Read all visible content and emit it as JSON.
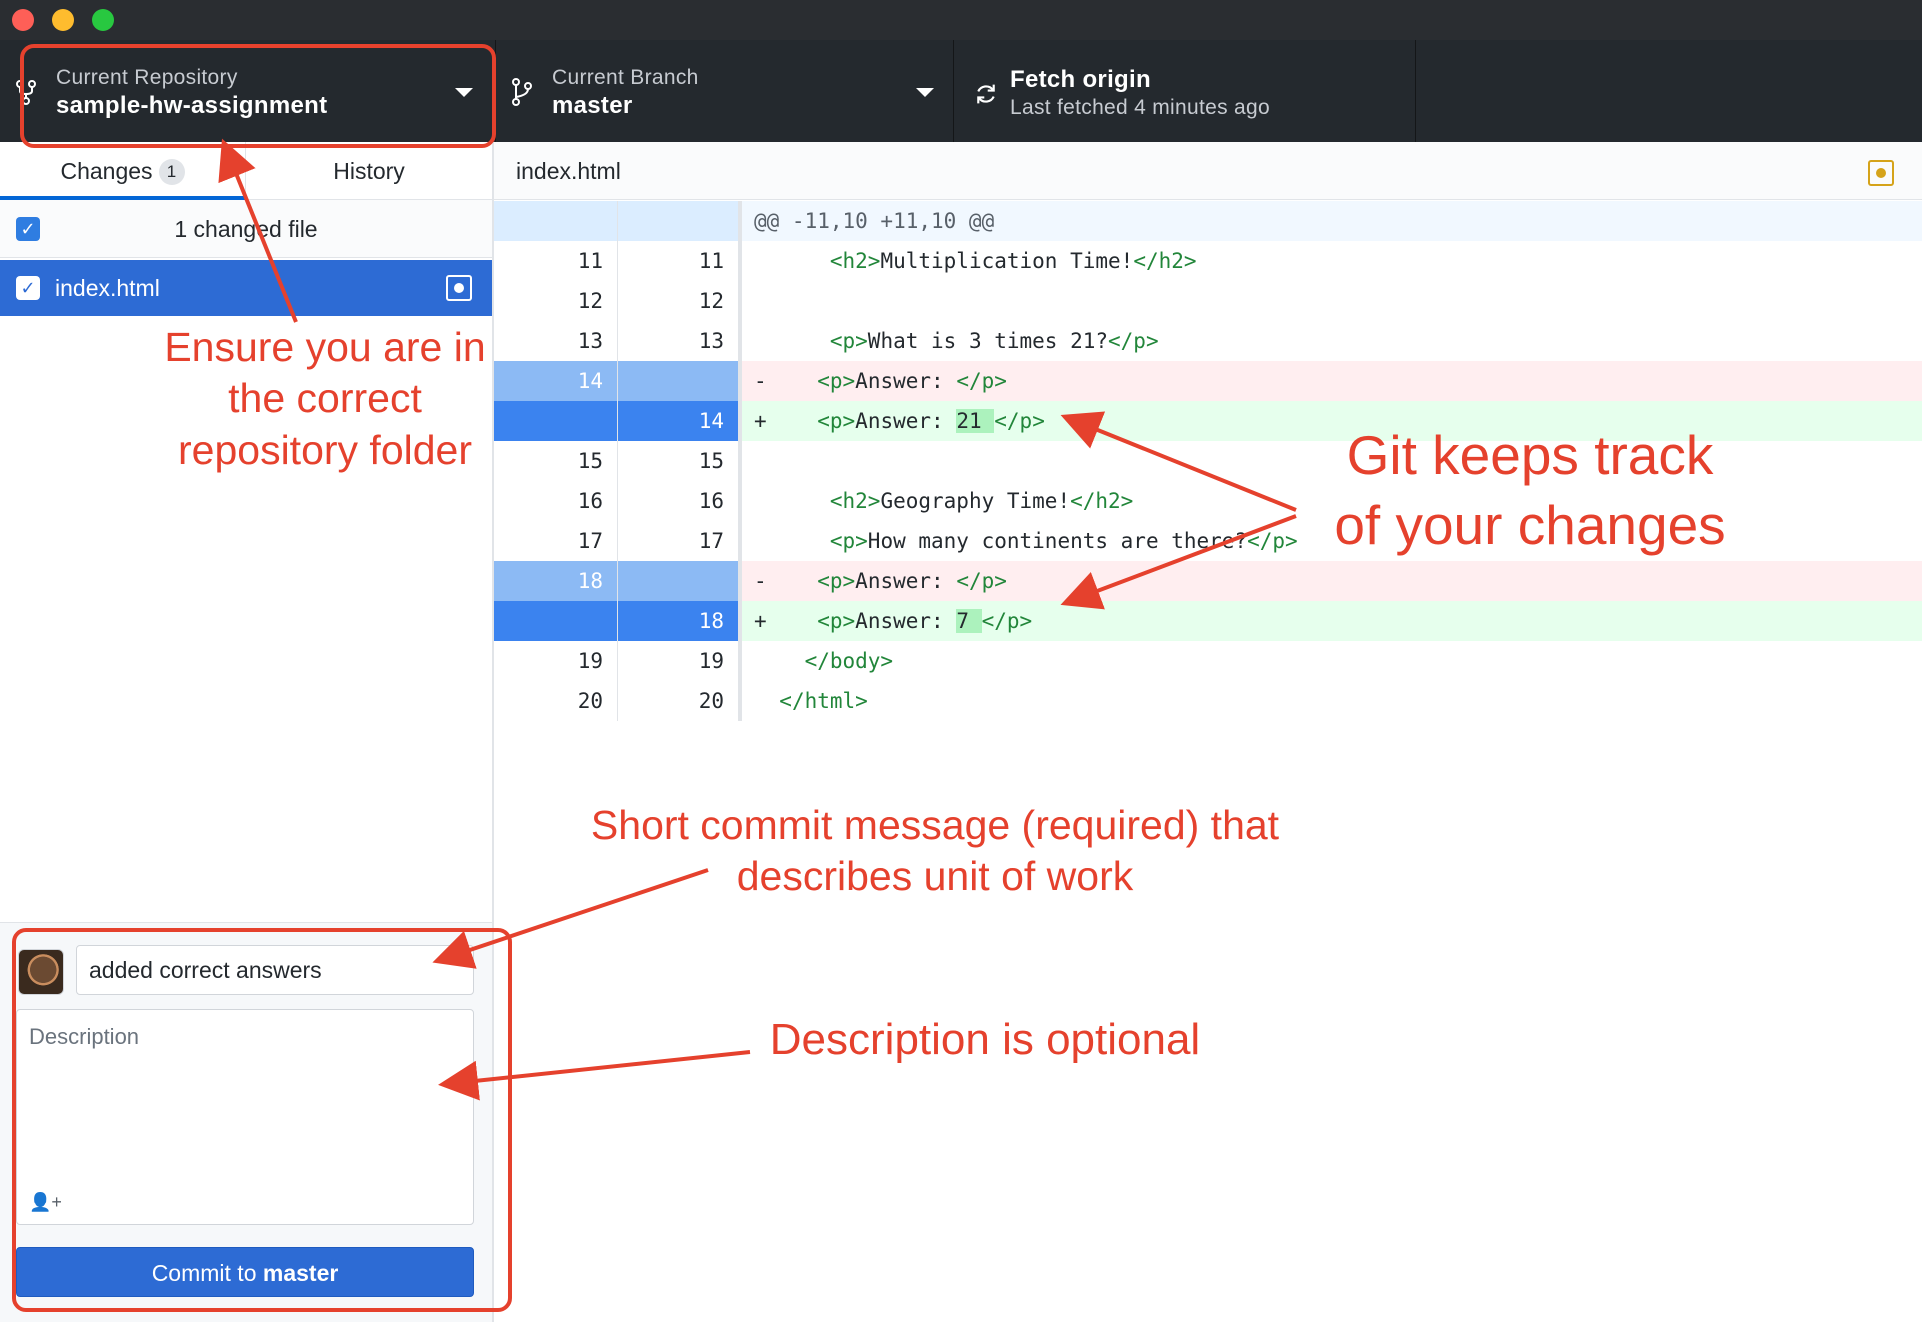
{
  "toolbar": {
    "repo_label": "Current Repository",
    "repo_value": "sample-hw-assignment",
    "branch_label": "Current Branch",
    "branch_value": "master",
    "fetch_label": "Fetch origin",
    "fetch_value": "Last fetched 4 minutes ago"
  },
  "sidebar": {
    "tabs": [
      {
        "label": "Changes",
        "badge": "1"
      },
      {
        "label": "History"
      }
    ],
    "changed_files_label": "1 changed file",
    "files": [
      {
        "name": "index.html",
        "checked": true
      }
    ]
  },
  "commit": {
    "summary_value": "added correct answers",
    "description_placeholder": "Description",
    "button_prefix": "Commit to",
    "button_branch": "master"
  },
  "diff": {
    "filename": "index.html",
    "hunk_header": "@@ -11,10 +11,10 @@",
    "lines": [
      {
        "type": "context",
        "old": "11",
        "new": "11",
        "sign": "",
        "indent": "    ",
        "pre": "<h2>",
        "text": "Multiplication Time!",
        "post": "</h2>",
        "hl": ""
      },
      {
        "type": "context",
        "old": "12",
        "new": "12",
        "sign": "",
        "indent": "",
        "pre": "",
        "text": "",
        "post": "",
        "hl": ""
      },
      {
        "type": "context",
        "old": "13",
        "new": "13",
        "sign": "",
        "indent": "    ",
        "pre": "<p>",
        "text": "What is 3 times 21?",
        "post": "</p>",
        "hl": ""
      },
      {
        "type": "del",
        "old": "14",
        "new": "",
        "sign": "-",
        "indent": "   ",
        "pre": "<p>",
        "text": "Answer: ",
        "post": "</p>",
        "hl": ""
      },
      {
        "type": "add",
        "old": "",
        "new": "14",
        "sign": "+",
        "indent": "   ",
        "pre": "<p>",
        "text": "Answer: ",
        "post": "</p>",
        "hl": "21 "
      },
      {
        "type": "context",
        "old": "15",
        "new": "15",
        "sign": "",
        "indent": "",
        "pre": "",
        "text": "",
        "post": "",
        "hl": ""
      },
      {
        "type": "context",
        "old": "16",
        "new": "16",
        "sign": "",
        "indent": "    ",
        "pre": "<h2>",
        "text": "Geography Time!",
        "post": "</h2>",
        "hl": ""
      },
      {
        "type": "context",
        "old": "17",
        "new": "17",
        "sign": "",
        "indent": "    ",
        "pre": "<p>",
        "text": "How many continents are there?",
        "post": "</p>",
        "hl": ""
      },
      {
        "type": "del",
        "old": "18",
        "new": "",
        "sign": "-",
        "indent": "   ",
        "pre": "<p>",
        "text": "Answer: ",
        "post": "</p>",
        "hl": ""
      },
      {
        "type": "add",
        "old": "",
        "new": "18",
        "sign": "+",
        "indent": "   ",
        "pre": "<p>",
        "text": "Answer: ",
        "post": "</p>",
        "hl": "7 "
      },
      {
        "type": "context",
        "old": "19",
        "new": "19",
        "sign": "",
        "indent": "  ",
        "pre": "</body>",
        "text": "",
        "post": "",
        "hl": ""
      },
      {
        "type": "context",
        "old": "20",
        "new": "20",
        "sign": "",
        "indent": "",
        "pre": "</html>",
        "text": "",
        "post": "",
        "hl": ""
      }
    ]
  },
  "annotations": {
    "repo_note_lines": [
      "Ensure you are in",
      "the correct",
      "repository folder"
    ],
    "git_note_lines": [
      "Git keeps track",
      "of your changes"
    ],
    "commit_note_lines": [
      "Short commit message (required) that",
      "describes unit of work"
    ],
    "description_note": "Description is optional",
    "color": "#e5412d"
  },
  "colors": {
    "toolbar_bg": "#24292e",
    "selection_blue": "#2d6bd4",
    "deleted_bg": "#ffeef0",
    "added_bg": "#e6ffed"
  }
}
